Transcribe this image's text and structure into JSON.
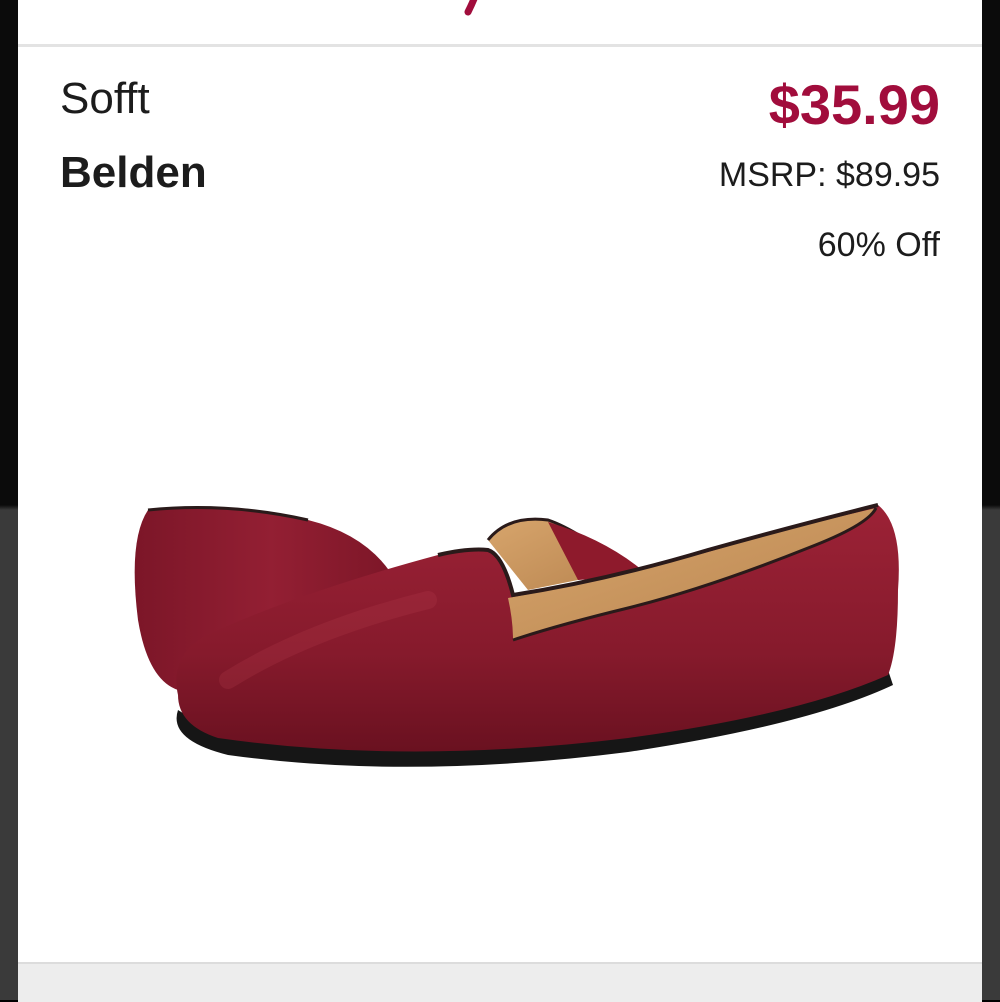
{
  "product": {
    "brand": "Sofft",
    "name": "Belden",
    "price": "$35.99",
    "msrp": "MSRP: $89.95",
    "discount": "60% Off",
    "image_icon": "shoe-product-image"
  },
  "colors": {
    "price": "#a10d3c",
    "shoe": "#8e1a2c",
    "lining": "#c9955e",
    "sole": "#1a1a1a"
  }
}
